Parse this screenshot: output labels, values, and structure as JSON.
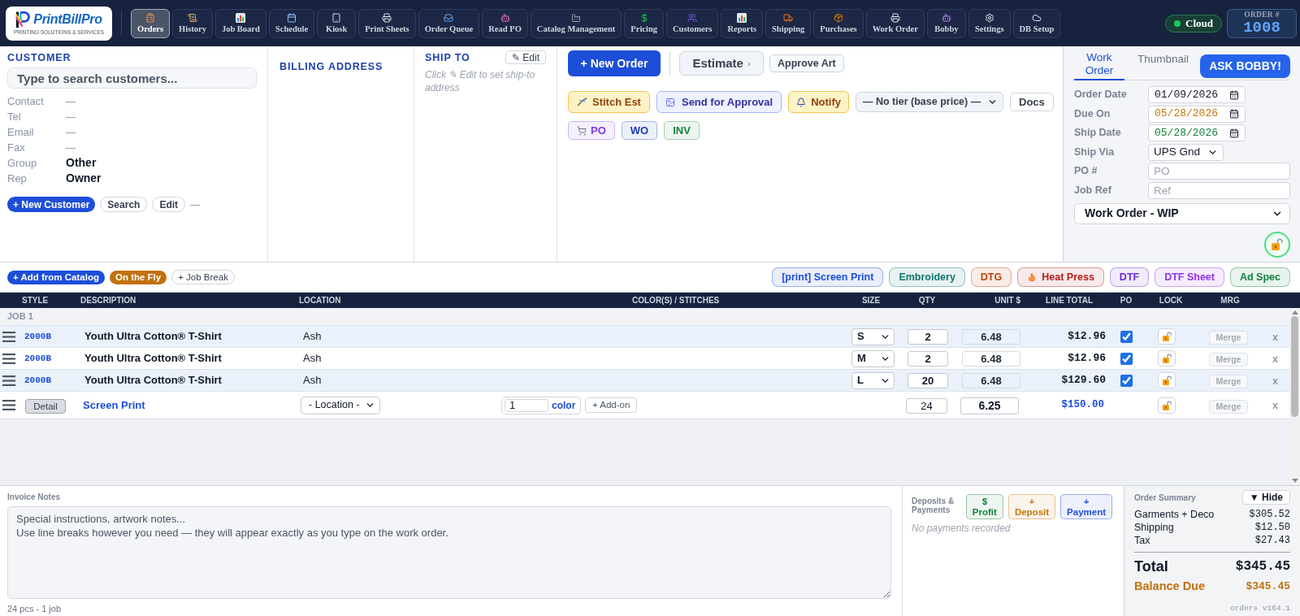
{
  "header": {
    "logo": {
      "name": "PrintBillPro",
      "tagline": "PRINTING SOLUTIONS & SERVICES"
    },
    "nav": [
      {
        "label": "Orders",
        "selected": true
      },
      {
        "label": "History",
        "selected": false
      },
      {
        "label": "Job Board",
        "selected": false
      },
      {
        "label": "Schedule",
        "selected": false
      },
      {
        "label": "Kiosk",
        "selected": false
      },
      {
        "label": "Print Sheets",
        "selected": false
      },
      {
        "label": "Order Queue",
        "selected": false
      },
      {
        "label": "Read PO",
        "selected": false
      },
      {
        "label": "Catalog Management",
        "selected": false
      },
      {
        "label": "Pricing",
        "selected": false
      },
      {
        "label": "Customers",
        "selected": false
      },
      {
        "label": "Reports",
        "selected": false
      },
      {
        "label": "Shipping",
        "selected": false
      },
      {
        "label": "Purchases",
        "selected": false
      },
      {
        "label": "Work Order",
        "selected": false
      },
      {
        "label": "Bobby",
        "selected": false
      },
      {
        "label": "Settings",
        "selected": false
      },
      {
        "label": "DB Setup",
        "selected": false
      }
    ],
    "cloud": {
      "label": "Cloud",
      "connected": true
    },
    "order_number": {
      "label": "ORDER #",
      "value": "1008"
    }
  },
  "customer": {
    "heading": "CUSTOMER",
    "search": {
      "placeholder": "Type to search customers..."
    },
    "fields": [
      {
        "label": "Contact",
        "placeholder": "—"
      },
      {
        "label": "Tel",
        "placeholder": "—"
      },
      {
        "label": "Email",
        "placeholder": "—"
      },
      {
        "label": "Fax",
        "placeholder": "—"
      },
      {
        "label": "Group",
        "value": "Other"
      },
      {
        "label": "Rep",
        "value": "Owner"
      }
    ],
    "new_customer": "+ New Customer",
    "search_button": "Search",
    "edit_button": "Edit",
    "note": "—"
  },
  "billing_address": {
    "heading": "BILLING ADDRESS"
  },
  "ship_to": {
    "heading": "SHIP TO",
    "edit_button": "✎ Edit",
    "hint": "Click ✎ Edit to set ship-to address"
  },
  "order_actions": {
    "new_order": "+ New Order",
    "estimate": {
      "label": "Estimate",
      "caret": "›"
    },
    "approve_art": "Approve Art",
    "stitch_estimate": "Stitch Est",
    "send_for_approval": "Send for Approval",
    "notify": "Notify",
    "price_tier": {
      "value": "— No tier (base price) —"
    },
    "docs": "Docs",
    "documents": [
      {
        "label": "PO",
        "color": "#7c3aed"
      },
      {
        "label": "WO",
        "color": "#1e40af"
      },
      {
        "label": "INV",
        "color": "#15803d"
      }
    ]
  },
  "work_panel": {
    "tabs": [
      {
        "label": "Work Order",
        "selected": true
      },
      {
        "label": "Thumbnail",
        "selected": false
      }
    ],
    "ask_button": "ASK BOBBY!",
    "fields": [
      {
        "label": "Order Date",
        "kind": "date",
        "value": "01/09/2026",
        "color": "#111827"
      },
      {
        "label": "Due On",
        "kind": "date",
        "value": "05/28/2026",
        "color": "#c2780c"
      },
      {
        "label": "Ship Date",
        "kind": "date",
        "value": "05/28/2026",
        "color": "#15803d"
      },
      {
        "label": "Ship Via",
        "kind": "select",
        "value": "UPS Gnd"
      },
      {
        "label": "PO #",
        "kind": "text",
        "placeholder": "PO"
      },
      {
        "label": "Job Ref",
        "kind": "text",
        "placeholder": "Ref"
      }
    ],
    "status": {
      "value": "Work Order - WIP"
    },
    "locked": false
  },
  "line_toolbar": {
    "add_from_catalog": "+ Add from Catalog",
    "on_the_fly": "On the Fly",
    "job_break": "+ Job Break",
    "methods": [
      {
        "label": "[print] Screen Print",
        "color": "#1d4ed8"
      },
      {
        "label": "Embroidery",
        "color": "#0f766e"
      },
      {
        "label": "DTG",
        "color": "#c2410c"
      },
      {
        "label": "Heat Press",
        "color": "#b91c1c"
      },
      {
        "label": "DTF",
        "color": "#6d28d9"
      },
      {
        "label": "DTF Sheet",
        "color": "#9333ea"
      },
      {
        "label": "Ad Spec",
        "color": "#15803d"
      }
    ]
  },
  "table": {
    "columns": [
      "STYLE",
      "DESCRIPTION",
      "LOCATION",
      "COLOR(S) / STITCHES",
      "SIZE",
      "QTY",
      "UNIT $",
      "LINE TOTAL",
      "PO",
      "LOCK",
      "MRG"
    ],
    "groups": [
      {
        "label": "JOB 1",
        "rows": [
          {
            "kind": "garment",
            "style": "2000B",
            "description": "Youth Ultra Cotton® T-Shirt",
            "location": "Ash",
            "size": "S",
            "qty": "2",
            "unit": "6.48",
            "line_total": "$12.96",
            "po": true,
            "locked": false,
            "merge": {
              "label": "Merge",
              "disabled": true
            },
            "remove": "x"
          },
          {
            "kind": "garment",
            "style": "2000B",
            "description": "Youth Ultra Cotton® T-Shirt",
            "location": "Ash",
            "size": "M",
            "qty": "2",
            "unit": "6.48",
            "line_total": "$12.96",
            "po": true,
            "locked": false,
            "merge": {
              "label": "Merge",
              "disabled": true
            },
            "remove": "x"
          },
          {
            "kind": "garment",
            "style": "2000B",
            "description": "Youth Ultra Cotton® T-Shirt",
            "location": "Ash",
            "size": "L",
            "qty": "20",
            "unit": "6.48",
            "line_total": "$129.60",
            "po": true,
            "locked": false,
            "merge": {
              "label": "Merge",
              "disabled": true
            },
            "remove": "x"
          },
          {
            "kind": "decoration",
            "detail": "Detail",
            "method": "Screen Print",
            "location": {
              "value": "- Location -"
            },
            "colors": "1",
            "colors_label": "color",
            "addon": "+ Add-on",
            "qty": "24",
            "unit": "6.25",
            "line_total": "$150.00",
            "locked": false,
            "merge": {
              "label": "Merge",
              "disabled": true
            },
            "remove": "x"
          }
        ]
      }
    ]
  },
  "invoice_notes": {
    "label": "Invoice Notes",
    "placeholder": "Special instructions, artwork notes...\nUse line breaks however you need — they will appear exactly as you type on the work order.",
    "summary": "24 pcs - 1 job"
  },
  "payments": {
    "label": "Deposits & Payments",
    "buttons": [
      {
        "symbol": "$",
        "label": "Profit",
        "color": "#15803d"
      },
      {
        "symbol": "+",
        "label": "Deposit",
        "color": "#c2780c"
      },
      {
        "symbol": "+",
        "label": "Payment",
        "color": "#1d4ed8"
      }
    ],
    "empty_text": "No payments recorded"
  },
  "order_summary": {
    "label": "Order Summary",
    "toggle": "▼ Hide",
    "lines": [
      {
        "label": "Garments + Deco",
        "value": "$305.52"
      },
      {
        "label": "Shipping",
        "value": "$12.50"
      },
      {
        "label": "Tax",
        "value": "$27.43"
      }
    ],
    "total": {
      "label": "Total",
      "value": "$345.45"
    },
    "balance_due": {
      "label": "Balance Due",
      "value": "$345.45"
    },
    "version": "orders v164.1"
  }
}
